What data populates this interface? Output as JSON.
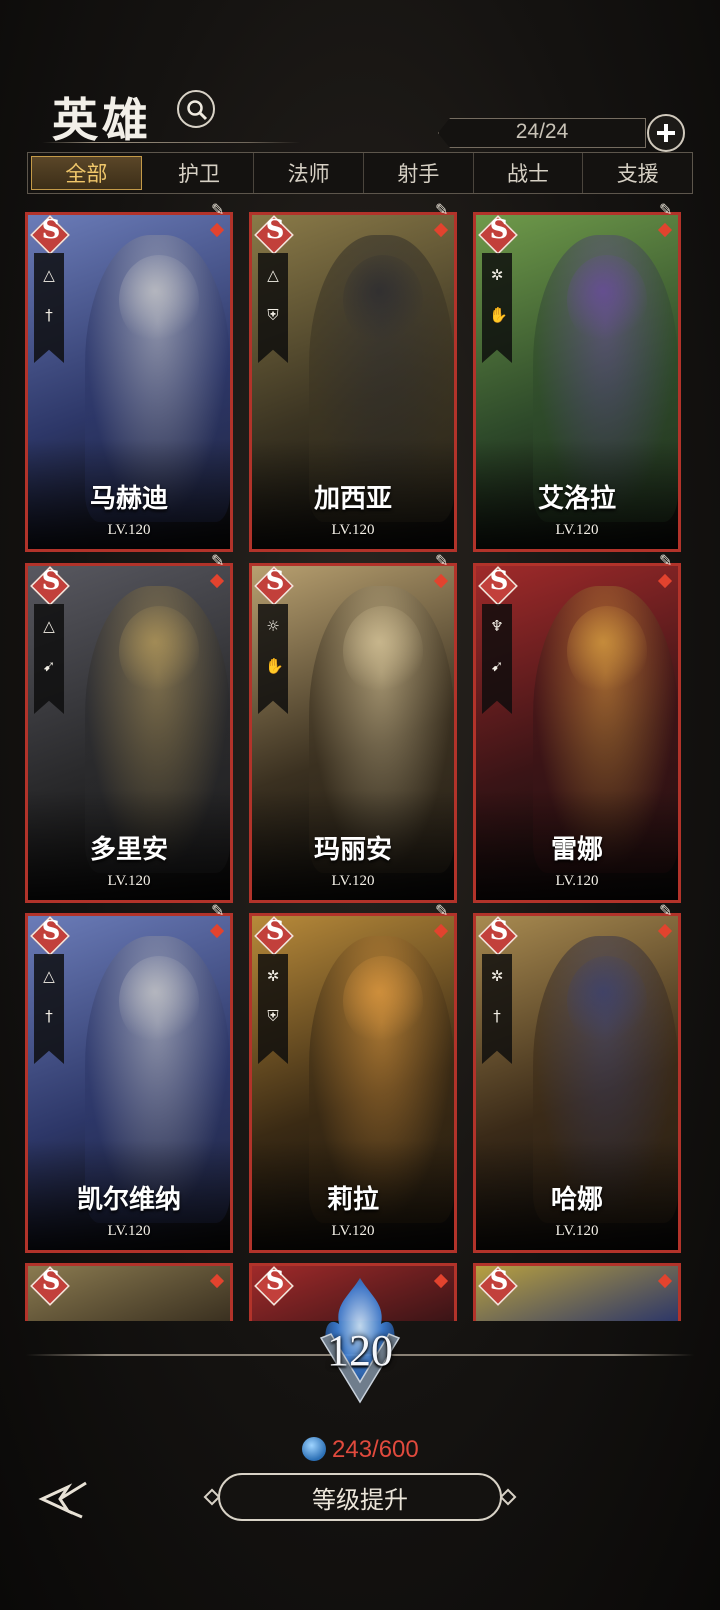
{
  "header": {
    "title": "英雄",
    "hero_count": "24/24"
  },
  "tabs": [
    {
      "label": "全部",
      "active": true
    },
    {
      "label": "护卫",
      "active": false
    },
    {
      "label": "法师",
      "active": false
    },
    {
      "label": "射手",
      "active": false
    },
    {
      "label": "战士",
      "active": false
    },
    {
      "label": "支援",
      "active": false
    }
  ],
  "heroes": [
    {
      "name": "马赫迪",
      "level": "LV.120",
      "rank": "S",
      "colors": [
        "#2d3768",
        "#6b7cb8",
        "#c9c9c9"
      ]
    },
    {
      "name": "加西亚",
      "level": "LV.120",
      "rank": "S",
      "colors": [
        "#3b3422",
        "#8a7a48",
        "#2a2a30"
      ]
    },
    {
      "name": "艾洛拉",
      "level": "LV.120",
      "rank": "S",
      "colors": [
        "#2e4a2a",
        "#6f9a4a",
        "#6a4aa0"
      ]
    },
    {
      "name": "多里安",
      "level": "LV.120",
      "rank": "S",
      "colors": [
        "#2a2a2c",
        "#585860",
        "#b59a5a"
      ]
    },
    {
      "name": "玛丽安",
      "level": "LV.120",
      "rank": "S",
      "colors": [
        "#3a3020",
        "#b8a070",
        "#d8c69a"
      ]
    },
    {
      "name": "雷娜",
      "level": "LV.120",
      "rank": "S",
      "colors": [
        "#3a1416",
        "#a02a2a",
        "#d8a040"
      ]
    },
    {
      "name": "凯尔维纳",
      "level": "LV.120",
      "rank": "S",
      "colors": [
        "#2d3768",
        "#6b7cb8",
        "#c9c9c9"
      ]
    },
    {
      "name": "莉拉",
      "level": "LV.120",
      "rank": "S",
      "colors": [
        "#3a2a14",
        "#b88a3a",
        "#e09a40"
      ]
    },
    {
      "name": "哈娜",
      "level": "LV.120",
      "rank": "S",
      "colors": [
        "#3a2a18",
        "#a88a50",
        "#3a4070"
      ]
    }
  ],
  "partial_heroes": [
    {
      "rank": "S",
      "colors": [
        "#3a3020",
        "#8a7a50"
      ]
    },
    {
      "rank": "S",
      "colors": [
        "#3a1416",
        "#a02a2a"
      ]
    },
    {
      "rank": "S",
      "colors": [
        "#2d3768",
        "#b8a040"
      ]
    }
  ],
  "level_panel": {
    "level": "120",
    "exp": "243/600",
    "upgrade_label": "等级提升"
  },
  "icons": {
    "search": "search-icon",
    "add": "plus-icon",
    "back": "back-arrow-icon",
    "exp": "blue-crystal-icon",
    "skin": "skin-icon"
  },
  "colors": {
    "card_border": "#b2332a",
    "tab_active": "#f0c76a",
    "exp_text": "#e14a3d"
  }
}
